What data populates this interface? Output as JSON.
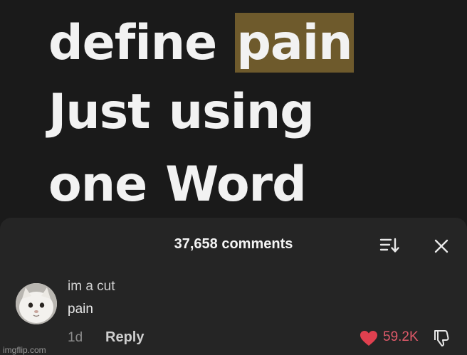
{
  "video": {
    "line1_word1": "define",
    "line1_word2": "pain",
    "line2_word1": "Just",
    "line2_word2": "using",
    "line3_word1": "one",
    "line3_word2": "Word",
    "highlight_color": "#6e5a2c"
  },
  "comments_sheet": {
    "count_label": "37,658 comments",
    "sort_icon": "sort-icon",
    "close_icon": "close-icon"
  },
  "comment": {
    "username": "im a cut",
    "text": "pain",
    "time": "1d",
    "reply_label": "Reply",
    "likes": "59.2K",
    "liked": true,
    "like_color": "#e0404f"
  },
  "watermark": "imgflip.com"
}
